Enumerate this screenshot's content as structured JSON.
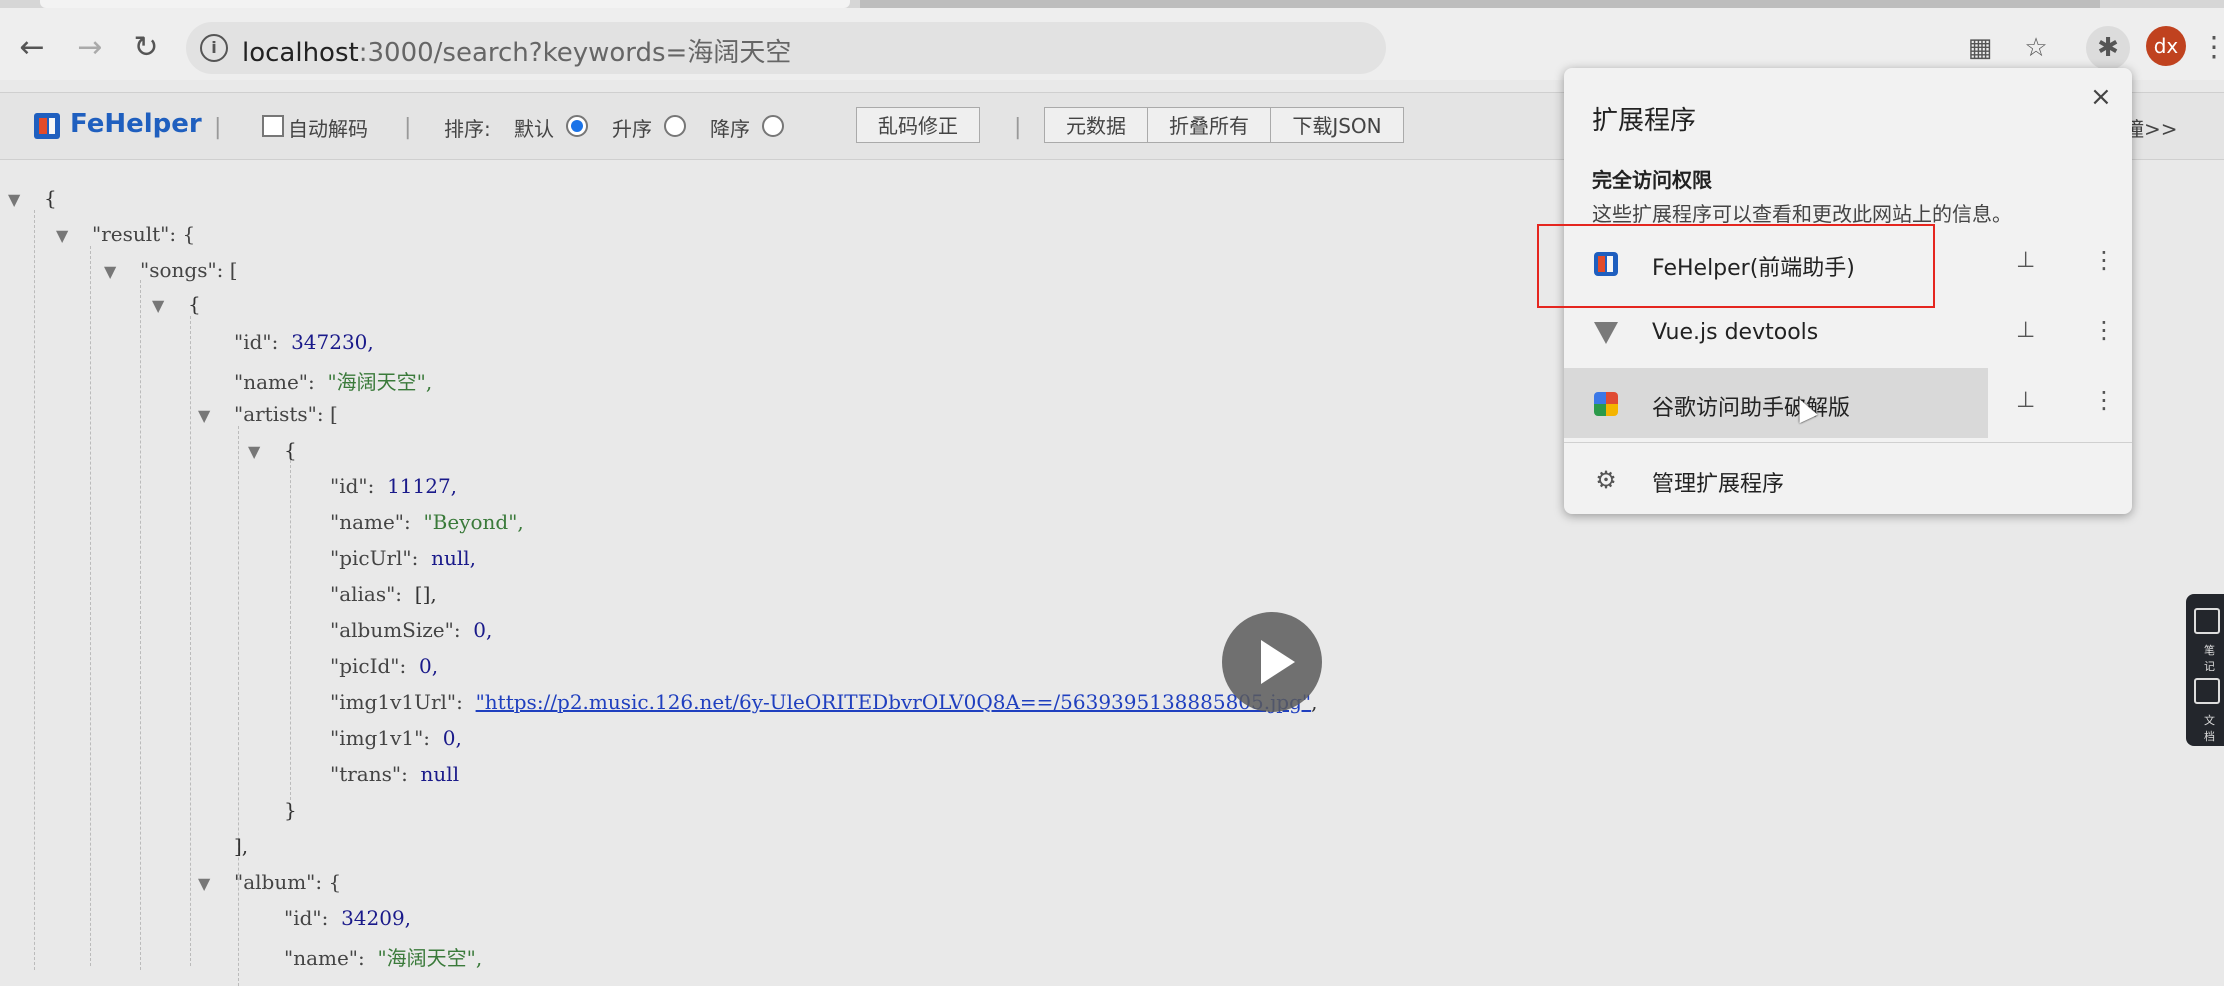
{
  "browser": {
    "url_host": "localhost",
    "url_rest": ":3000/search?keywords=海阔天空",
    "avatar": "dx",
    "icons": [
      "back-icon",
      "forward-icon",
      "reload-icon",
      "info-icon",
      "qr-icon",
      "star-icon",
      "puzzle-icon"
    ]
  },
  "fehelper": {
    "title": "FeHelper",
    "auto_decode": "自动解码",
    "sort_label": "排序:",
    "sort_default": "默认",
    "sort_asc": "升序",
    "sort_desc": "降序",
    "fix_encoding": "乱码修正",
    "metadata": "元数据",
    "collapse_all": "折叠所有",
    "download_json": "下载JSON",
    "more": "瞳>>"
  },
  "json": {
    "lines": [
      "{",
      "\"result\":  {",
      "\"songs\":  [",
      "{",
      "\"id\":",
      "347230,",
      "\"name\":",
      "\"海阔天空\",",
      "\"artists\":  [",
      "{",
      "\"id\":",
      "11127,",
      "\"name\":",
      "\"Beyond\",",
      "\"picUrl\":",
      "null,",
      "\"alias\":",
      "[],",
      "\"albumSize\":",
      "0,",
      "\"picId\":",
      "0,",
      "\"img1v1Url\":",
      "\"https://p2.music.126.net/6y-UleORITEDbvrOLV0Q8A==/5639395138885805.jpg\"",
      ",",
      "\"img1v1\":",
      "0,",
      "\"trans\":",
      "null",
      "}",
      "],",
      "\"album\":  {",
      "\"id\":",
      "34209,",
      "\"name\":",
      "\"海阔天空\","
    ]
  },
  "extensions": {
    "title": "扩展程序",
    "close": "×",
    "section": "完全访问权限",
    "description": "这些扩展程序可以查看和更改此网站上的信息。",
    "items": [
      {
        "name": "FeHelper(前端助手)",
        "icon": "fehelper-icon"
      },
      {
        "name": "Vue.js devtools",
        "icon": "vue-icon"
      },
      {
        "name": "谷歌访问助手破解版",
        "icon": "google-helper-icon"
      }
    ],
    "manage": "管理扩展程序"
  },
  "side_widget": {
    "label1": "笔记",
    "label2": "文档"
  },
  "colors": {
    "fehelper_blue": "#1f5fbf",
    "highlight_red": "#e5261f",
    "avatar": "#c0421f"
  }
}
